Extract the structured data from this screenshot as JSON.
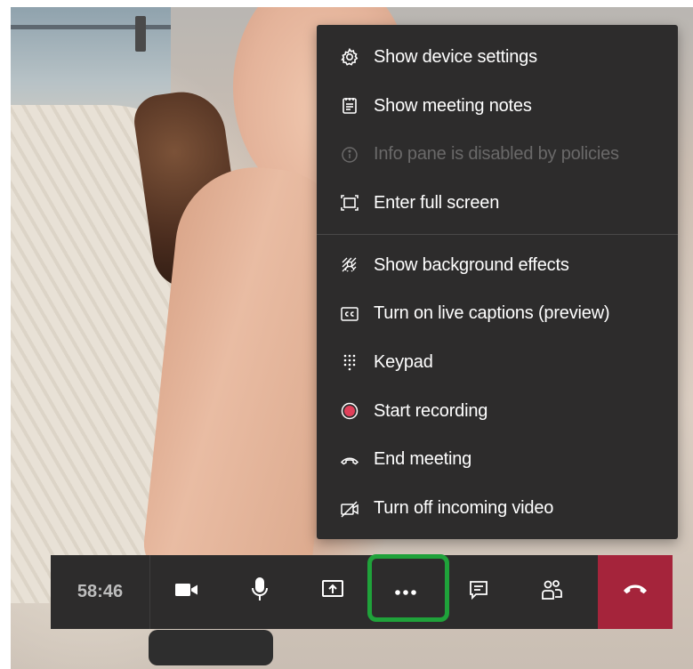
{
  "menu": {
    "items": [
      {
        "label": "Show device settings",
        "icon": "gear-icon",
        "enabled": true
      },
      {
        "label": "Show meeting notes",
        "icon": "notes-icon",
        "enabled": true
      },
      {
        "label": "Info pane is disabled by policies",
        "icon": "info-icon",
        "enabled": false
      },
      {
        "label": "Enter full screen",
        "icon": "fullscreen-icon",
        "enabled": true
      },
      {
        "label": "Show background effects",
        "icon": "background-effects-icon",
        "enabled": true
      },
      {
        "label": "Turn on live captions (preview)",
        "icon": "captions-icon",
        "enabled": true
      },
      {
        "label": "Keypad",
        "icon": "keypad-icon",
        "enabled": true
      },
      {
        "label": "Start recording",
        "icon": "record-icon",
        "enabled": true
      },
      {
        "label": "End meeting",
        "icon": "end-meeting-icon",
        "enabled": true
      },
      {
        "label": "Turn off incoming video",
        "icon": "video-off-icon",
        "enabled": true
      }
    ]
  },
  "controlbar": {
    "timer": "58:46",
    "buttons": [
      "camera-icon",
      "microphone-icon",
      "share-screen-icon",
      "more-options-icon",
      "chat-icon",
      "participants-icon",
      "hang-up-icon"
    ]
  },
  "colors": {
    "panel": "#2d2c2c",
    "highlight": "#1fa23a",
    "hangup": "#a5243b",
    "record": "#e0405a"
  }
}
